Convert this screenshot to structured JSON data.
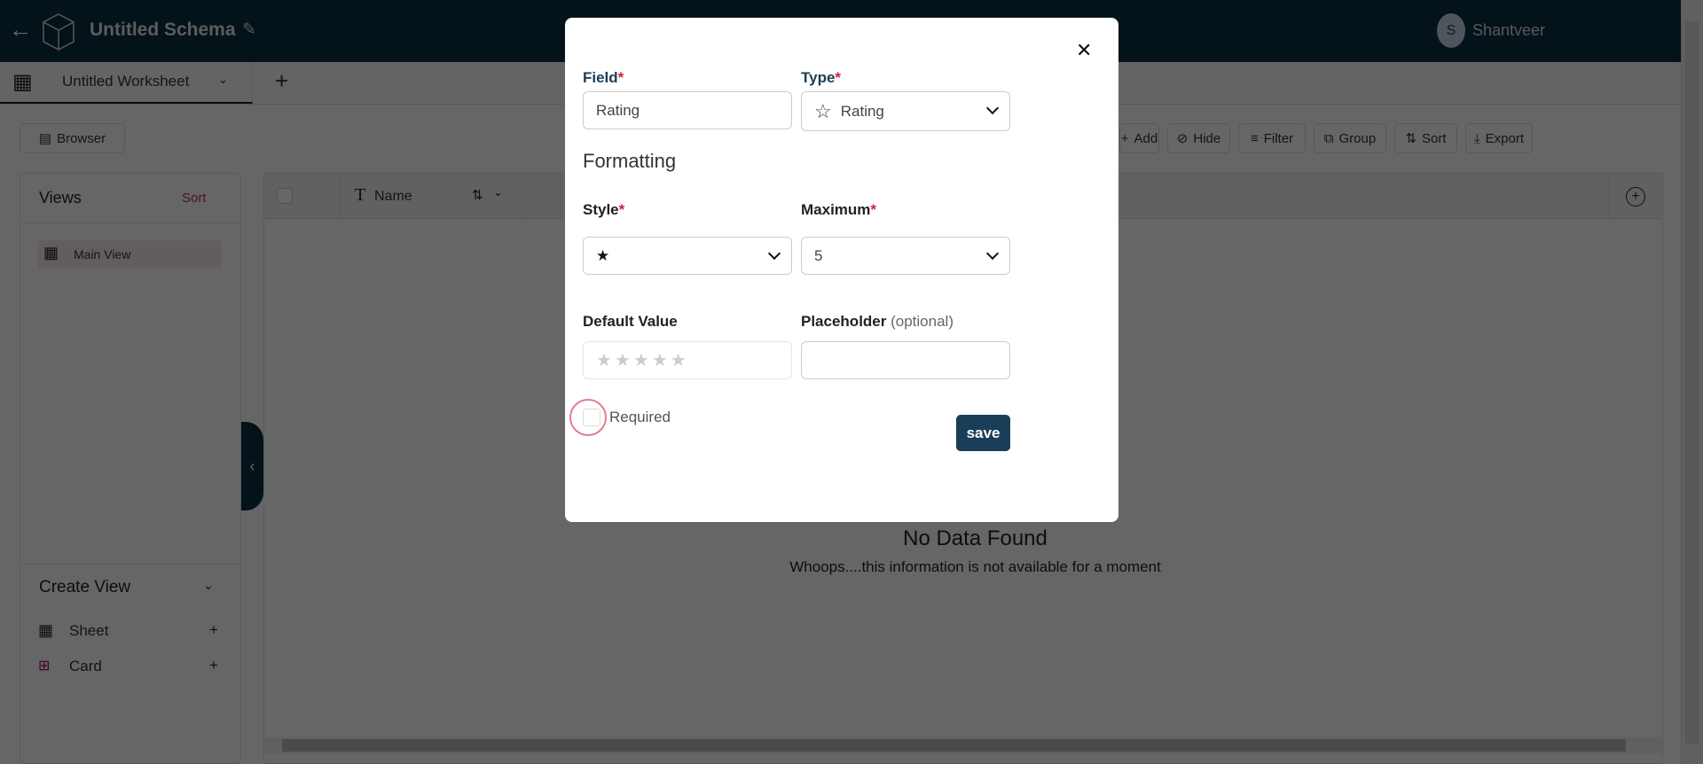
{
  "header": {
    "title": "Untitled Schema",
    "user_initial": "S",
    "user_name": "Shantveer"
  },
  "tabs": {
    "worksheet": "Untitled Worksheet",
    "add": "+"
  },
  "toolbar": {
    "browser": "Browser",
    "add": "Add",
    "hide": "Hide",
    "filter": "Filter",
    "group": "Group",
    "sort": "Sort",
    "export": "Export"
  },
  "views": {
    "title": "Views",
    "sort": "Sort",
    "items": [
      {
        "label": "Main View"
      }
    ],
    "create_title": "Create View",
    "create_items": [
      {
        "label": "Sheet"
      },
      {
        "label": "Card"
      }
    ]
  },
  "table": {
    "columns": [
      {
        "label": "Name"
      }
    ],
    "empty_title": "No Data Found",
    "empty_message": "Whoops....this information is not available for a moment"
  },
  "modal": {
    "field_label": "Field",
    "field_value": "Rating",
    "type_label": "Type",
    "type_value": "Rating",
    "section": "Formatting",
    "style_label": "Style",
    "style_value": "★",
    "maximum_label": "Maximum",
    "maximum_value": "5",
    "default_label": "Default Value",
    "default_rating": 0,
    "default_max": 5,
    "placeholder_label": "Placeholder",
    "placeholder_optional": "(optional)",
    "placeholder_value": "",
    "required_label": "Required",
    "required_checked": false,
    "save": "save",
    "required_mark": "*"
  },
  "colors": {
    "brand": "#0b2d42",
    "accent": "#d0203a"
  }
}
